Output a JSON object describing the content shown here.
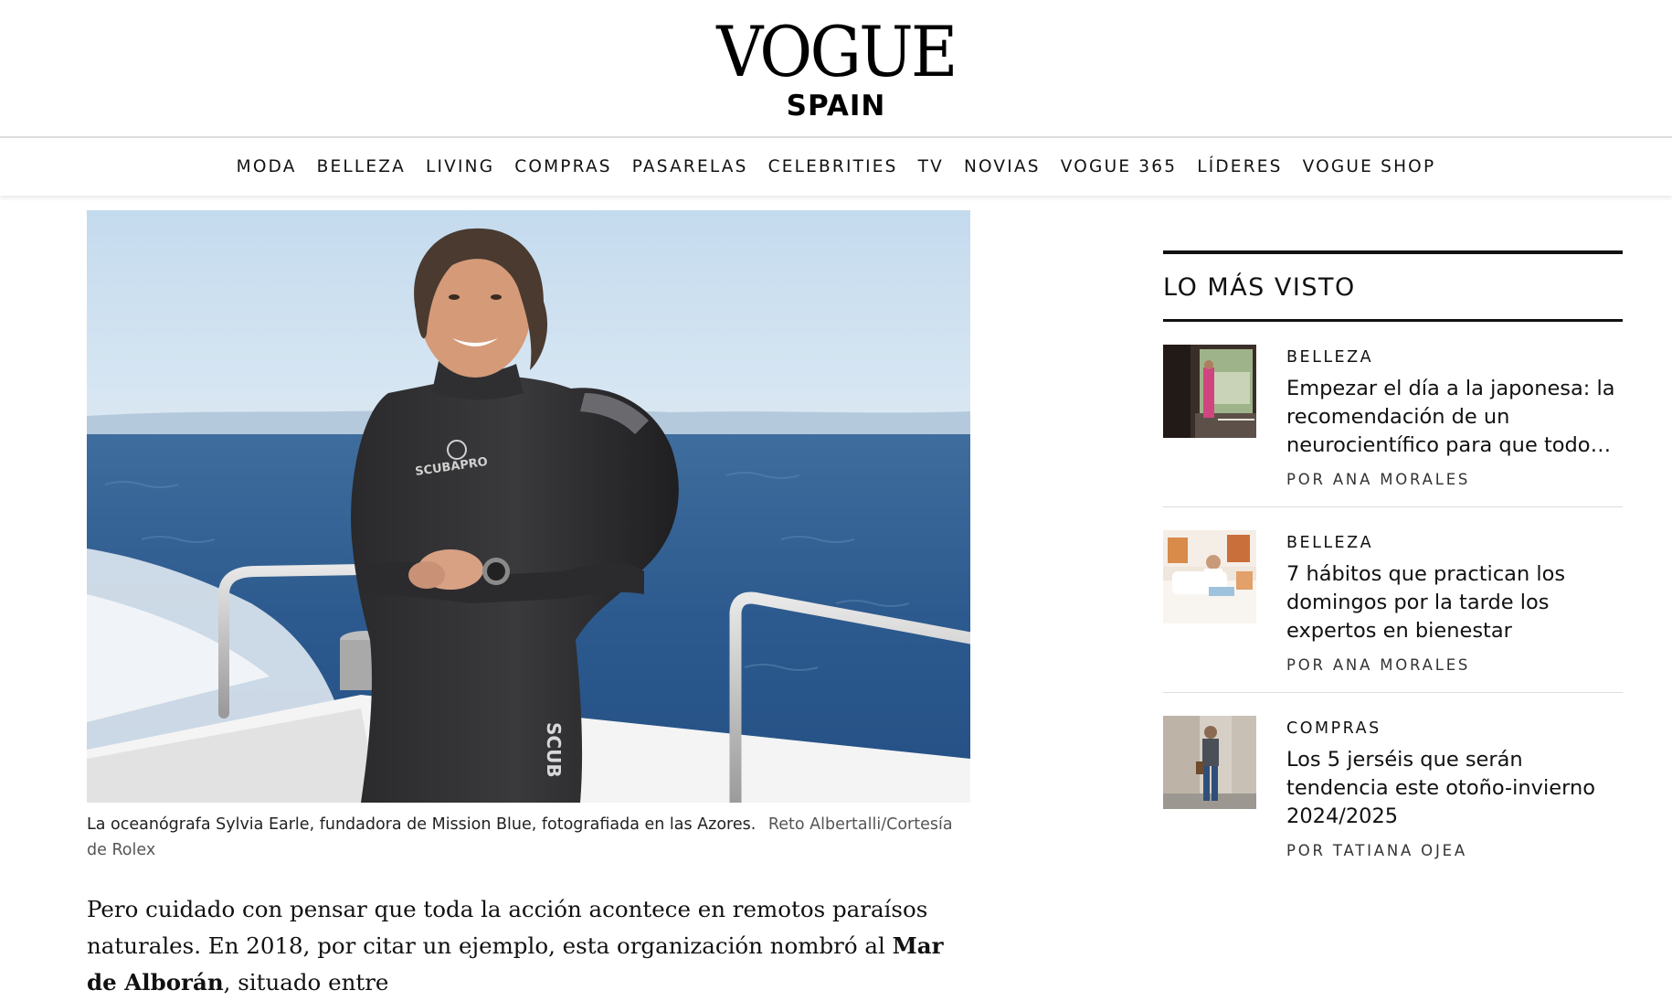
{
  "header": {
    "logo_main": "VOGUE",
    "logo_sub": "SPAIN"
  },
  "nav": {
    "items": [
      "MODA",
      "BELLEZA",
      "LIVING",
      "COMPRAS",
      "PASARELAS",
      "CELEBRITIES",
      "TV",
      "NOVIAS",
      "VOGUE 365",
      "LÍDERES",
      "VOGUE SHOP"
    ]
  },
  "hero": {
    "caption": "La oceanógrafa Sylvia Earle, fundadora de Mission Blue, fotografiada en las Azores.",
    "credit": "Reto Albertalli/Cortesía de Rolex",
    "wetsuit_logo": "SCUBAPRO",
    "leg_logo": "SCUB"
  },
  "article": {
    "p1_start": "Pero cuidado con pensar que toda la acción acontece en remotos paraísos naturales. En 2018, por citar un ejemplo, esta organización nombró al ",
    "p1_bold": "Mar de Alborán",
    "p1_end": ", situado entre"
  },
  "sidebar": {
    "title": "LO MÁS VISTO",
    "stories": [
      {
        "category": "BELLEZA",
        "title": "Empezar el día a la japonesa: la recomendación de un neurocientífico para que todo se…",
        "author": "POR ANA MORALES"
      },
      {
        "category": "BELLEZA",
        "title": "7 hábitos que practican los domingos por la tarde los expertos en bienestar",
        "author": "POR ANA MORALES"
      },
      {
        "category": "COMPRAS",
        "title": "Los 5 jerséis que serán tendencia este otoño-invierno 2024/2025",
        "author": "POR TATIANA OJEA"
      }
    ]
  }
}
